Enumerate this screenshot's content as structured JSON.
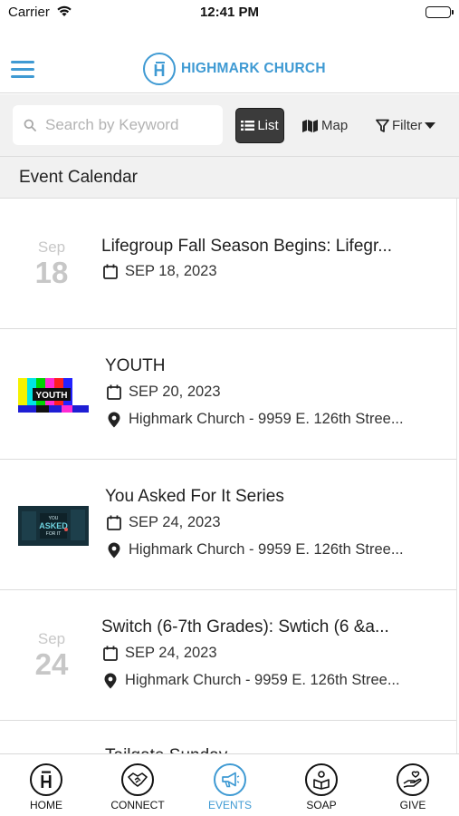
{
  "status_bar": {
    "carrier": "Carrier",
    "time": "12:41 PM"
  },
  "header": {
    "brand_mark": "H",
    "brand_name": "HIGHMARK CHURCH",
    "brand_color": "#3f9ad3"
  },
  "toolbar": {
    "search_placeholder": "Search by Keyword",
    "search_value": "",
    "list_label": "List",
    "map_label": "Map",
    "filter_label": "Filter",
    "active_view": "List"
  },
  "section": {
    "title": "Event Calendar"
  },
  "events": [
    {
      "title": "Lifegroup Fall Season Begins: Lifegr...",
      "badge_month": "Sep",
      "badge_day": "18",
      "date": "SEP 18, 2023",
      "location": ""
    },
    {
      "title": "YOUTH",
      "thumbnail": "YOUTH",
      "date": "SEP 20, 2023",
      "location": "Highmark Church - 9959 E. 126th Stree..."
    },
    {
      "title": "You Asked For It Series",
      "thumbnail": "ASKED",
      "date": "SEP 24, 2023",
      "location": "Highmark Church - 9959 E. 126th Stree..."
    },
    {
      "title": "Switch (6-7th Grades): Swtich (6 &a...",
      "badge_month": "Sep",
      "badge_day": "24",
      "date": "SEP 24, 2023",
      "location": "Highmark Church - 9959 E. 126th Stree..."
    },
    {
      "title": "Tailgate Sunday",
      "date": "",
      "location": ""
    }
  ],
  "tabbar": {
    "active": "EVENTS",
    "active_color": "#3f9ad3",
    "tabs": [
      {
        "label": "HOME",
        "icon": "home-logo-icon"
      },
      {
        "label": "CONNECT",
        "icon": "handshake-icon"
      },
      {
        "label": "EVENTS",
        "icon": "megaphone-icon"
      },
      {
        "label": "SOAP",
        "icon": "reading-person-icon"
      },
      {
        "label": "GIVE",
        "icon": "giving-hand-icon"
      }
    ]
  }
}
